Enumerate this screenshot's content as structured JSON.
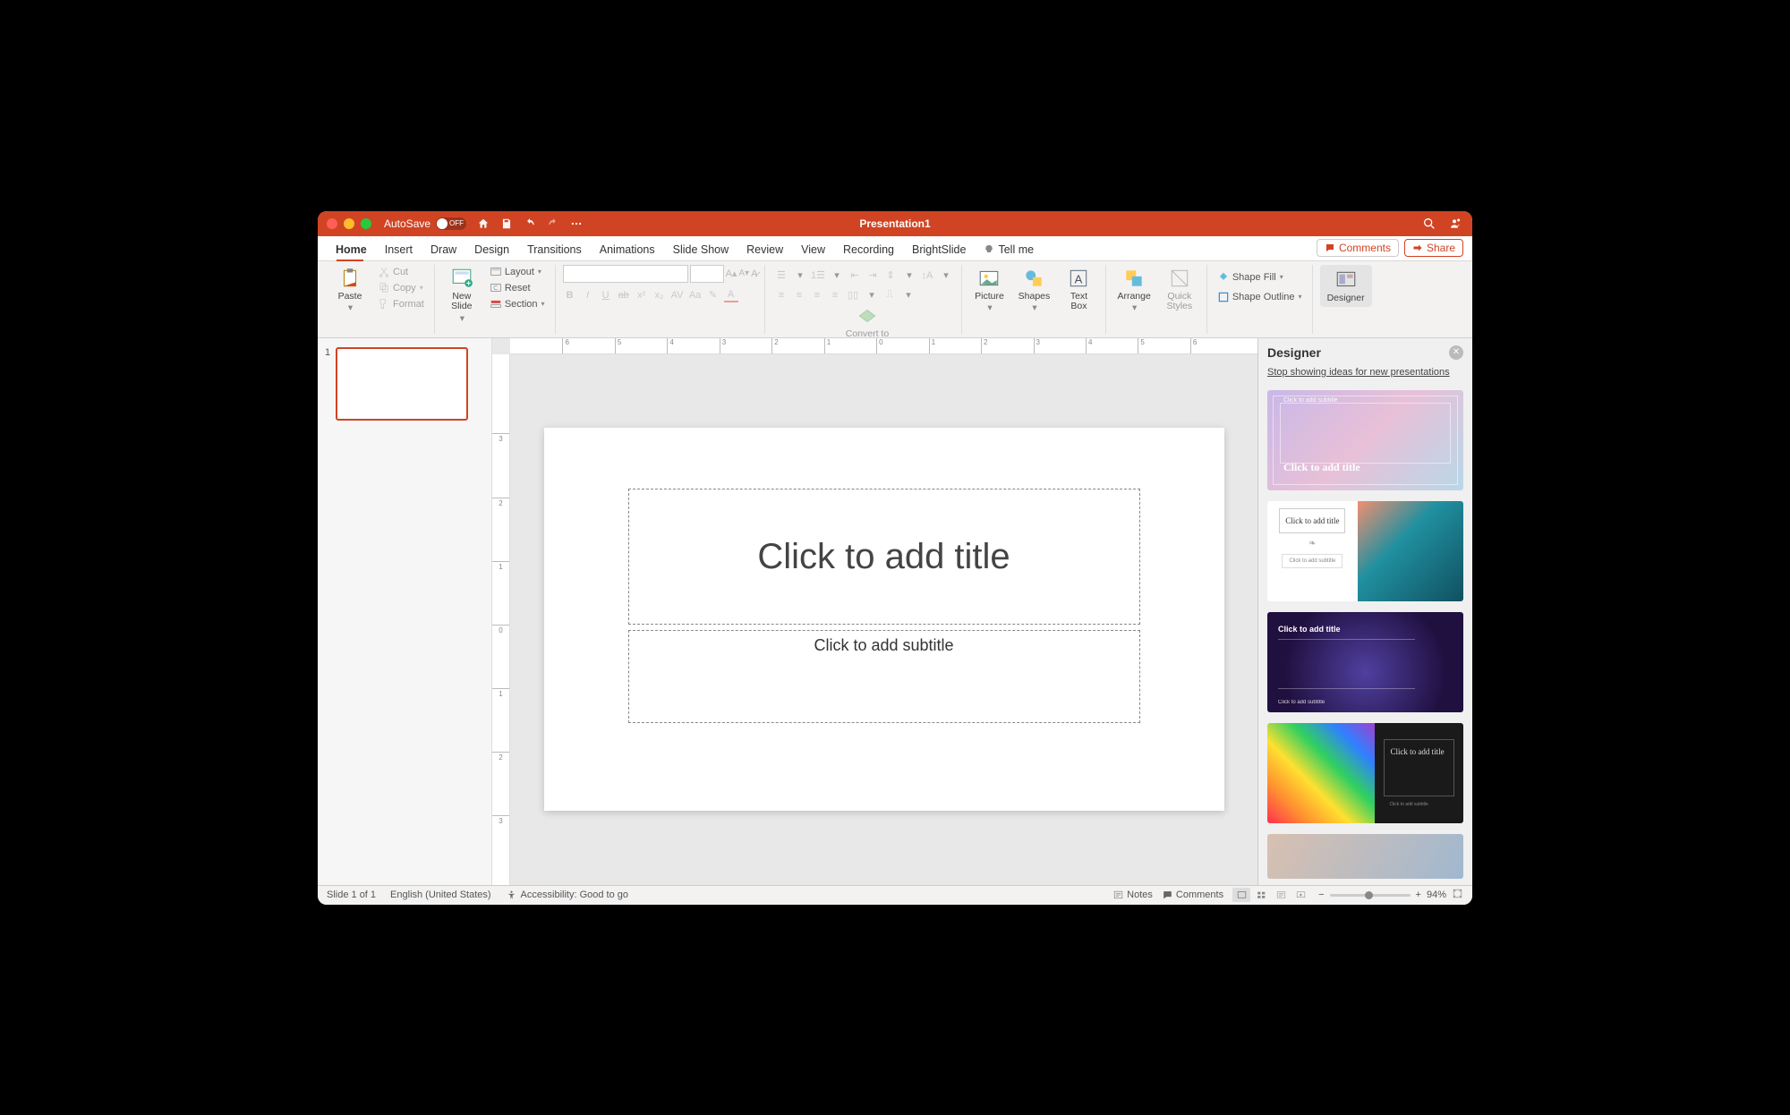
{
  "titlebar": {
    "autosave_label": "AutoSave",
    "autosave_state": "OFF",
    "doc_title": "Presentation1"
  },
  "tabs": [
    "Home",
    "Insert",
    "Draw",
    "Design",
    "Transitions",
    "Animations",
    "Slide Show",
    "Review",
    "View",
    "Recording",
    "BrightSlide",
    "Tell me"
  ],
  "tabs_right": {
    "comments": "Comments",
    "share": "Share"
  },
  "ribbon": {
    "paste": "Paste",
    "cut": "Cut",
    "copy": "Copy",
    "format": "Format",
    "new_slide": "New\nSlide",
    "layout": "Layout",
    "reset": "Reset",
    "section": "Section",
    "convert": "Convert to\nSmartArt",
    "picture": "Picture",
    "shapes": "Shapes",
    "textbox": "Text\nBox",
    "arrange": "Arrange",
    "quick": "Quick\nStyles",
    "shapefill": "Shape Fill",
    "shapeoutline": "Shape Outline",
    "designer": "Designer"
  },
  "thumbs": {
    "num": "1"
  },
  "slide": {
    "title_ph": "Click to add title",
    "sub_ph": "Click to add subtitle"
  },
  "designer": {
    "title": "Designer",
    "stop_link": "Stop showing ideas for new presentations",
    "idea_title": "Click to add title",
    "idea_sub": "Click to add subtitle"
  },
  "status": {
    "slide": "Slide 1 of 1",
    "lang": "English (United States)",
    "access": "Accessibility: Good to go",
    "notes": "Notes",
    "comments": "Comments",
    "zoom": "94%"
  }
}
